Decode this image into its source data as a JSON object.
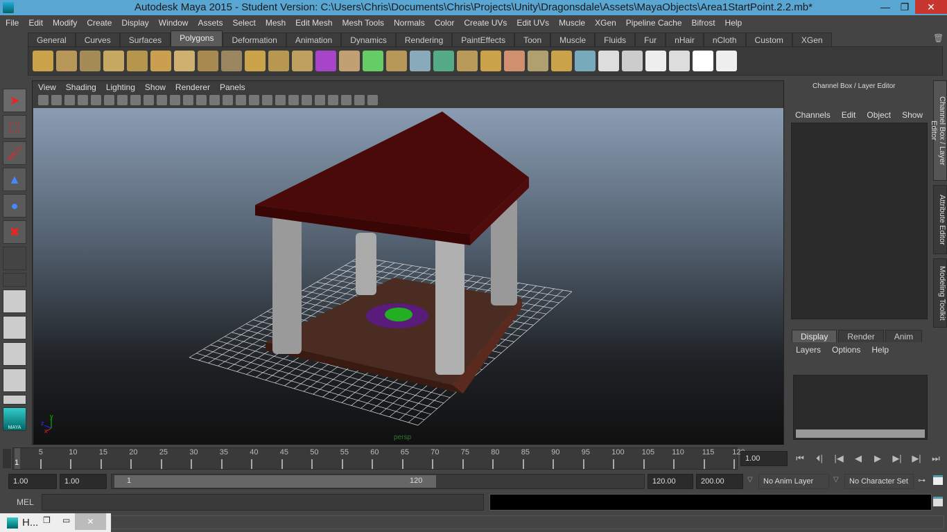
{
  "window": {
    "title": "Autodesk Maya 2015 - Student Version: C:\\Users\\Chris\\Documents\\Chris\\Projects\\Unity\\Dragonsdale\\Assets\\MayaObjects\\Area1StartPoint.2.2.mb*",
    "minimize": "—",
    "restore": "❐",
    "close": "✕"
  },
  "menubar": [
    "File",
    "Edit",
    "Modify",
    "Create",
    "Display",
    "Window",
    "Assets",
    "Select",
    "Mesh",
    "Edit Mesh",
    "Mesh Tools",
    "Normals",
    "Color",
    "Create UVs",
    "Edit UVs",
    "Muscle",
    "XGen",
    "Pipeline Cache",
    "Bifrost",
    "Help"
  ],
  "shelf": {
    "tabs": [
      "General",
      "Curves",
      "Surfaces",
      "Polygons",
      "Deformation",
      "Animation",
      "Dynamics",
      "Rendering",
      "PaintEffects",
      "Toon",
      "Muscle",
      "Fluids",
      "Fur",
      "nHair",
      "nCloth",
      "Custom",
      "XGen"
    ],
    "active": "Polygons"
  },
  "viewport": {
    "menu": [
      "View",
      "Shading",
      "Lighting",
      "Show",
      "Renderer",
      "Panels"
    ],
    "camera_label": "persp",
    "axis": {
      "y": "y",
      "z": "z",
      "x": "x"
    }
  },
  "channel_box": {
    "title": "Channel Box / Layer Editor",
    "menu": [
      "Channels",
      "Edit",
      "Object",
      "Show"
    ]
  },
  "layer_editor": {
    "tabs": [
      "Display",
      "Render",
      "Anim"
    ],
    "active": "Display",
    "menu": [
      "Layers",
      "Options",
      "Help"
    ]
  },
  "side_tabs": [
    "Channel Box / Layer Editor",
    "Attribute Editor",
    "Modeling Toolkit"
  ],
  "timeline": {
    "ticks": [
      "5",
      "10",
      "15",
      "20",
      "25",
      "30",
      "35",
      "40",
      "45",
      "50",
      "55",
      "60",
      "65",
      "70",
      "75",
      "80",
      "85",
      "90",
      "95",
      "100",
      "105",
      "110",
      "115",
      "120"
    ],
    "current_frame": "1",
    "current_time": "1.00"
  },
  "range": {
    "start": "1.00",
    "playback_start": "1.00",
    "slider_start": "1",
    "slider_end": "120",
    "playback_end": "120.00",
    "end": "200.00",
    "anim_layer": "No Anim Layer",
    "character_set": "No Character Set"
  },
  "command": {
    "label": "MEL"
  },
  "taskbar": {
    "label": "H..."
  },
  "toolbox": {
    "logo": "MAYA"
  }
}
